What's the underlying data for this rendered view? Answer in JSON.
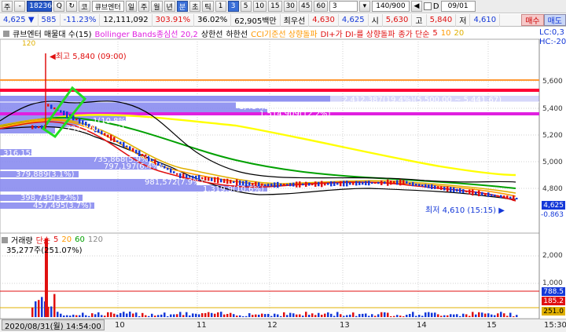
{
  "toolbar": {
    "menu_labels": [
      "주",
      "-"
    ],
    "code": "182360",
    "q_icon": "Q",
    "icon_btn": "↻",
    "market_label": "코",
    "stock_name": "큐브엔터",
    "period_buttons": [
      "일",
      "주",
      "월",
      "년",
      "분",
      "초",
      "틱"
    ],
    "active_period": "분",
    "interval_buttons": [
      "1",
      "3",
      "5",
      "10",
      "15",
      "30",
      "45",
      "60"
    ],
    "active_interval": "3",
    "interval_value": "3",
    "count": "140/900",
    "date_label": "D",
    "date": "09/01"
  },
  "quote": {
    "price": "4,625",
    "change": "585",
    "change_pct": "-11.23%",
    "volume": "12,111,092",
    "vol_ratio": "303.91%",
    "turnover_pct": "36.02%",
    "amount": "62,905백만",
    "best_label": "최우선",
    "ask": "4,630",
    "bid": "4,625",
    "open_label": "시",
    "open": "5,630",
    "high_label": "고",
    "high": "5,840",
    "low_label": "저",
    "low": "4,610",
    "buy": "매수",
    "sell": "매도"
  },
  "legend": {
    "items": [
      {
        "text": "큐브엔터 매물대 수(15)",
        "color": "#000000"
      },
      {
        "text": "Bollinger Bands종심선 20,2",
        "color": "#e020e0"
      },
      {
        "text": "상한선",
        "color": "#000000"
      },
      {
        "text": "하한선",
        "color": "#000000"
      },
      {
        "text": "CCI기준선 상향돌파",
        "color": "#ff9900"
      },
      {
        "text": "DI+가 DI-를 상향돌파",
        "color": "#e01010"
      },
      {
        "text": "종가 단순",
        "color": "#e01010"
      },
      {
        "text": "5",
        "color": "#e01010"
      },
      {
        "text": "10",
        "color": "#ff9900"
      },
      {
        "text": "20",
        "color": "#e0b000"
      }
    ],
    "right": [
      "LC:0,3",
      "HC:-20"
    ]
  },
  "annotations": {
    "high_label": "최고 5,840 (09:00)",
    "low_label": "최저 4,610 (15:15)",
    "vp_labels": [
      "2,412,387(19.4%)(5,500.00 ~ 5,441.67)",
      "1,484,343(11.9%)",
      "1,514,909(12.2%)",
      "1(10.8%)(5.9%)",
      "297,500(4.0%)",
      "23.8(1.9%)",
      "0(0.0%)",
      "316,154(2.5%)",
      "735,868(5.9%)",
      "797,197(6.4%)",
      "379,889(3.1%)",
      "981,572(7.9%)",
      "1,319.9(10.6%)",
      "398,739(3.2%)",
      "457,495(3.7%)"
    ],
    "top_left_value": "120"
  },
  "y_axis": {
    "price_ticks": [
      "5,600",
      "5,400",
      "5,200",
      "5,000",
      "4,800"
    ],
    "current_price": "4,625",
    "current_change": "-0.863",
    "volume_ticks": [
      "2,000",
      "1,000"
    ],
    "vol_current_a": "788.5",
    "vol_current_b": "185.2",
    "vol_bottom": "251.0"
  },
  "volume": {
    "legend": [
      {
        "text": "거래량",
        "color": "#000000"
      },
      {
        "text": "단순",
        "color": "#e01010"
      },
      {
        "text": "5",
        "color": "#e01010"
      },
      {
        "text": "20",
        "color": "#ff9900"
      },
      {
        "text": "60",
        "color": "#00a000"
      },
      {
        "text": "120",
        "color": "#888888"
      }
    ],
    "value": "35,277주(251.07%)"
  },
  "bottom": {
    "datetime": "2020/08/31(월) 14:54:00",
    "time_ticks": [
      "10",
      "11",
      "12",
      "13",
      "14",
      "15"
    ],
    "right_time": "15:30"
  },
  "colors": {
    "price_up": "#e01010",
    "price_down": "#1438d8",
    "volume_profile": "#8a8cf0",
    "bb_mid": "#e020e0",
    "ma5": "#e01010",
    "ma10": "#ff9900",
    "ma20": "#e0b000",
    "ma60": "#00a000",
    "ma120": "#ffff00"
  }
}
